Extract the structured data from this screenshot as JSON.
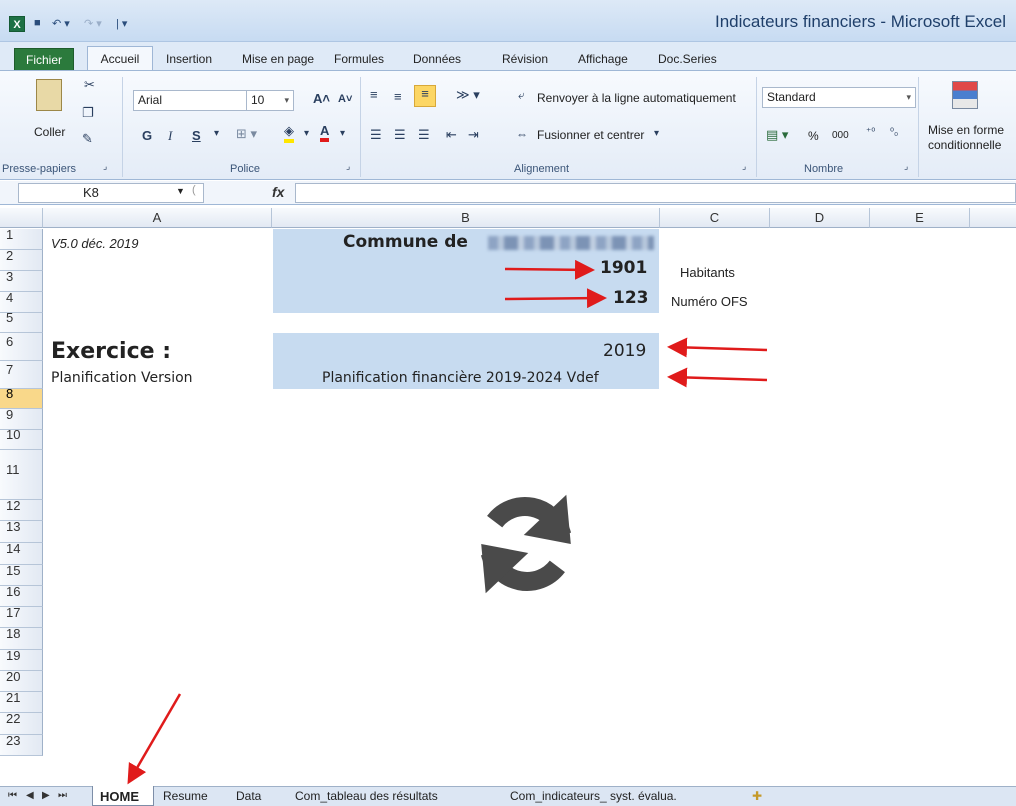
{
  "window": {
    "title": "Indicateurs financiers  -  Microsoft Excel"
  },
  "ribbon": {
    "tabs": [
      "Fichier",
      "Accueil",
      "Insertion",
      "Mise en page",
      "Formules",
      "Données",
      "Révision",
      "Affichage",
      "Doc.Series"
    ],
    "active_tab": "Accueil",
    "clipboard": {
      "paste_label": "Coller",
      "group": "Presse-papiers"
    },
    "font": {
      "name": "Arial",
      "size": "10",
      "group": "Police",
      "bold": "G",
      "italic": "I",
      "underline": "S"
    },
    "alignment": {
      "wrap": "Renvoyer à la ligne automatiquement",
      "merge": "Fusionner et centrer",
      "group": "Alignement"
    },
    "number": {
      "format": "Standard",
      "percent": "%",
      "thousands": "000",
      "group": "Nombre"
    },
    "styles": {
      "cond_format": "Mise en forme conditionnelle"
    }
  },
  "formula_bar": {
    "name_box": "K8",
    "fx": "fx",
    "formula": ""
  },
  "grid": {
    "columns": [
      "A",
      "B",
      "C",
      "D",
      "E"
    ],
    "rows": [
      "1",
      "2",
      "3",
      "4",
      "5",
      "6",
      "7",
      "8",
      "9",
      "10",
      "11",
      "12",
      "13",
      "14",
      "15",
      "16",
      "17",
      "18",
      "19",
      "20",
      "21",
      "22",
      "23"
    ],
    "selected_row": "8",
    "cells": {
      "a1": "V5.0 déc. 2019",
      "b1": "Commune de",
      "b2": "1901",
      "c2": "Habitants",
      "b3": "123",
      "c3": "Numéro OFS",
      "a5": "Exercice :",
      "b5": "2019",
      "a6": "Planification Version",
      "b6": "Planification financière 2019-2024 Vdef"
    }
  },
  "sheets": {
    "tabs": [
      "HOME",
      "Resume",
      "Data",
      "Com_tableau des résultats",
      "Com_indicateurs_ syst. évalua."
    ],
    "active": "HOME"
  },
  "colors": {
    "fill_blue": "#c7dbf0",
    "arrow_red": "#e01b1b",
    "excel_green": "#1e7145",
    "row_selected": "#f9d88a"
  }
}
